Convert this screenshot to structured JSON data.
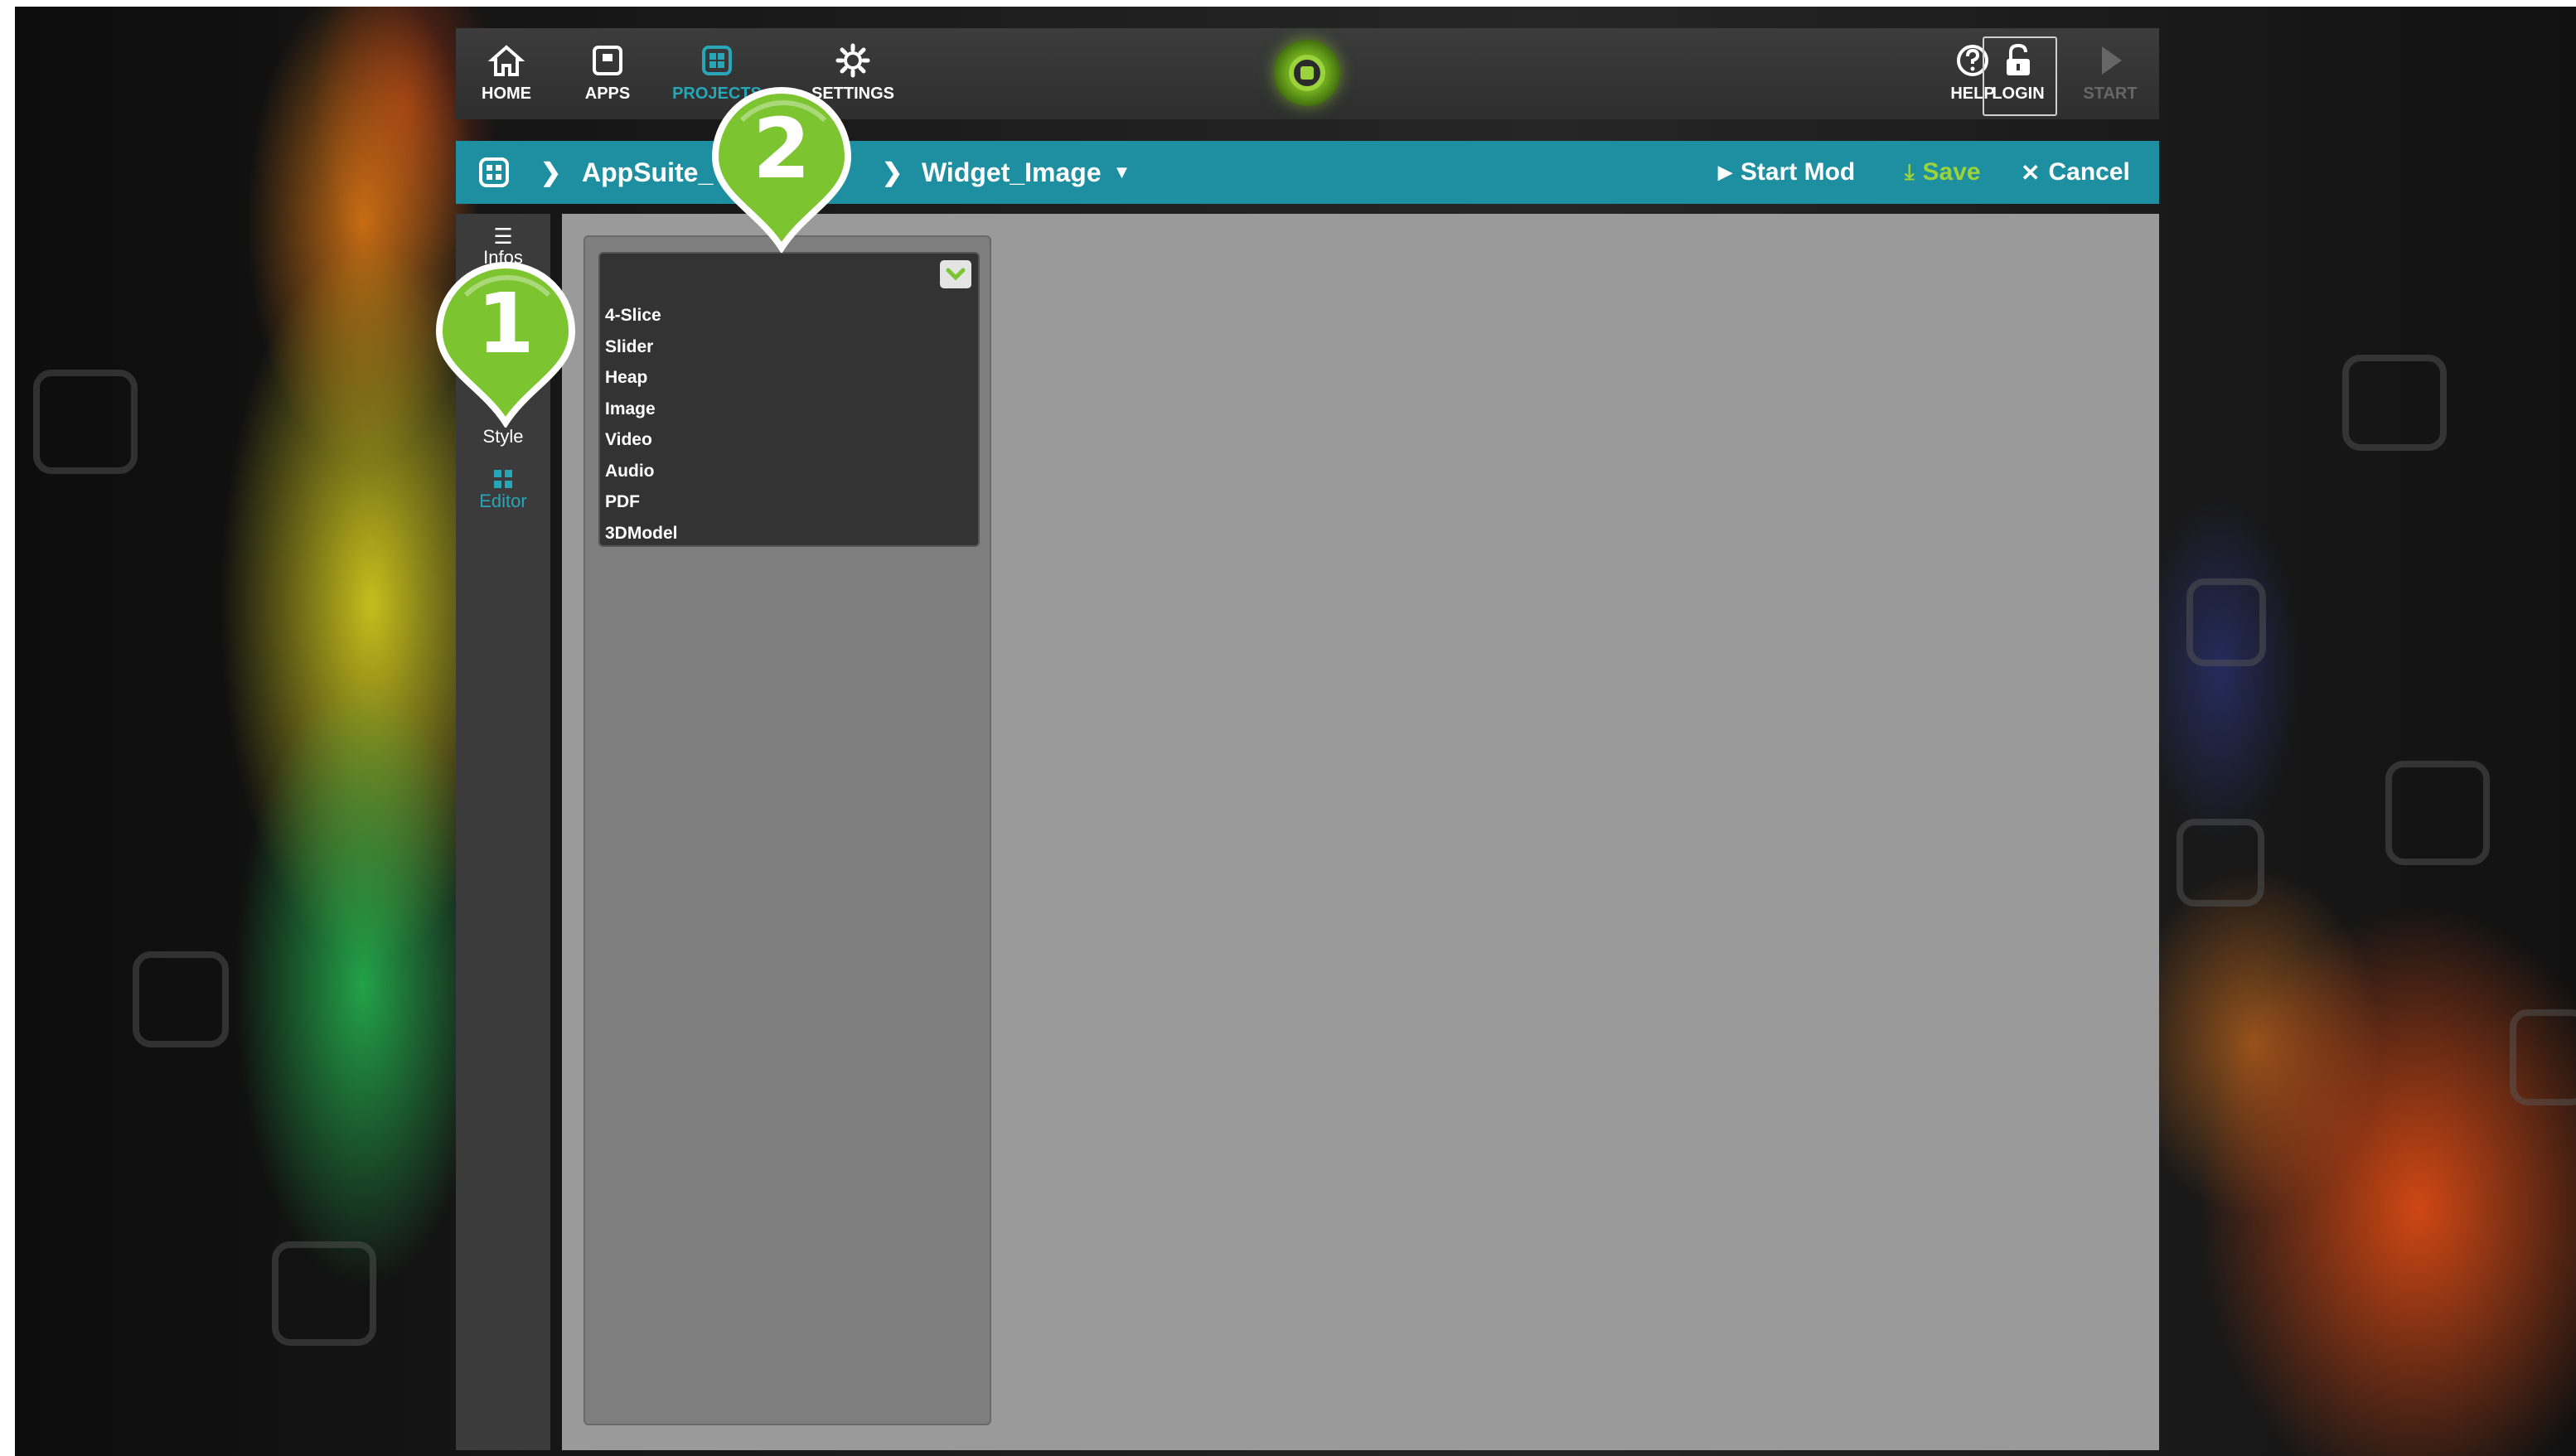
{
  "colors": {
    "accent_teal": "#1e8fa0",
    "active_nav": "#27a6b7",
    "save_green": "#9bd33a",
    "marker_green": "#7cc530"
  },
  "topbar": {
    "nav": [
      {
        "label": "HOME",
        "icon": "home-icon"
      },
      {
        "label": "APPS",
        "icon": "apps-icon"
      },
      {
        "label": "PROJECTS",
        "icon": "projects-icon"
      },
      {
        "label": "SETTINGS",
        "icon": "gear-icon"
      }
    ],
    "right": [
      {
        "label": "HELP",
        "icon": "help-icon"
      },
      {
        "label": "LOGIN",
        "icon": "unlock-icon"
      },
      {
        "label": "START",
        "icon": "play-icon"
      }
    ]
  },
  "breadcrumb": {
    "project": "AppSuite_",
    "widget": "Widget_Image",
    "actions": {
      "start_mod": "Start Mod",
      "save": "Save",
      "cancel": "Cancel"
    }
  },
  "sidebar": {
    "infos": "Infos",
    "style": "Style",
    "editor": "Editor"
  },
  "widget_dropdown": {
    "options": [
      "4-Slice",
      "Slider",
      "Heap",
      "Image",
      "Video",
      "Audio",
      "PDF",
      "3DModel"
    ]
  },
  "markers": [
    {
      "number": "1"
    },
    {
      "number": "2"
    }
  ]
}
